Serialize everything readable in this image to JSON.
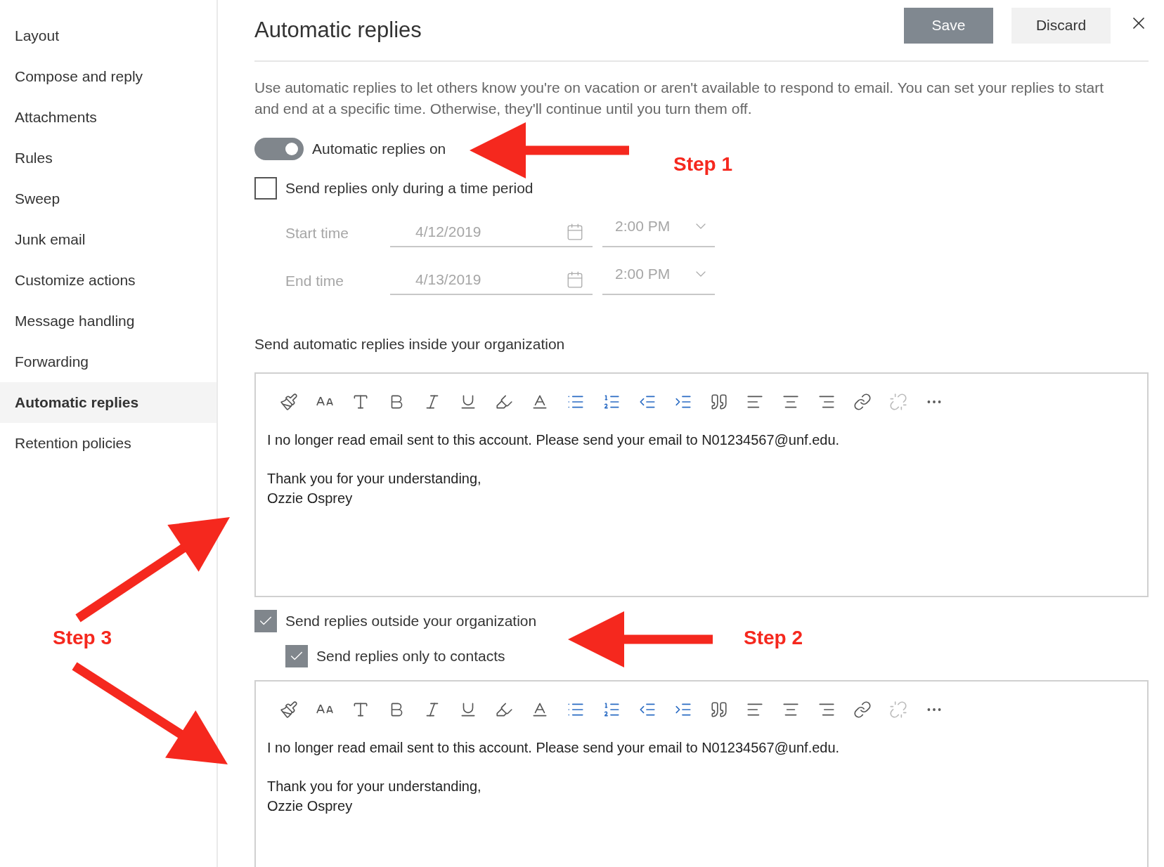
{
  "sidebar": {
    "items": [
      {
        "label": "Layout",
        "selected": false
      },
      {
        "label": "Compose and reply",
        "selected": false
      },
      {
        "label": "Attachments",
        "selected": false
      },
      {
        "label": "Rules",
        "selected": false
      },
      {
        "label": "Sweep",
        "selected": false
      },
      {
        "label": "Junk email",
        "selected": false
      },
      {
        "label": "Customize actions",
        "selected": false
      },
      {
        "label": "Message handling",
        "selected": false
      },
      {
        "label": "Forwarding",
        "selected": false
      },
      {
        "label": "Automatic replies",
        "selected": true
      },
      {
        "label": "Retention policies",
        "selected": false
      }
    ]
  },
  "header": {
    "title": "Automatic replies",
    "save": "Save",
    "discard": "Discard"
  },
  "description": "Use automatic replies to let others know you're on vacation or aren't available to respond to email. You can set your replies to start and end at a specific time. Otherwise, they'll continue until you turn them off.",
  "toggle": {
    "label": "Automatic replies on",
    "on": true
  },
  "time_period": {
    "label": "Send replies only during a time period",
    "checked": false,
    "rows": [
      {
        "label": "Start time",
        "date": "4/12/2019",
        "time": "2:00 PM"
      },
      {
        "label": "End time",
        "date": "4/13/2019",
        "time": "2:00 PM"
      }
    ]
  },
  "inside_label": "Send automatic replies inside your organization",
  "inside_message": {
    "paragraphs": [
      [
        "I no longer read email sent to this account. Please send your email to N01234567@unf.edu."
      ],
      [
        "Thank you for your understanding,",
        "Ozzie Osprey"
      ]
    ]
  },
  "outside": {
    "label": "Send replies outside your organization",
    "checked": true
  },
  "contacts_only": {
    "label": "Send replies only to contacts",
    "checked": true
  },
  "outside_message": {
    "paragraphs": [
      [
        "I no longer read email sent to this account. Please send your email to N01234567@unf.edu."
      ],
      [
        "Thank you for your understanding,",
        "Ozzie Osprey"
      ]
    ]
  },
  "annotations": [
    {
      "label": "Step 1"
    },
    {
      "label": "Step 2"
    },
    {
      "label": "Step 3"
    }
  ]
}
